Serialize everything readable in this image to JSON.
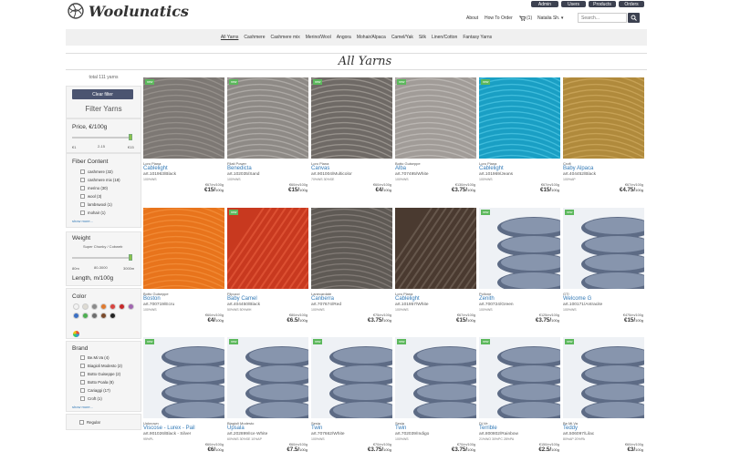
{
  "logo": {
    "text": "Woolunatics"
  },
  "top_buttons": [
    "Admin",
    "Users",
    "Products",
    "Orders"
  ],
  "top_nav": {
    "about": "About",
    "how": "How To Order",
    "cart": "(1)",
    "user": "Natalia Sh."
  },
  "search": {
    "placeholder": "Search..."
  },
  "categories": [
    "All Yarns",
    "Cashmere",
    "Cashmere mix",
    "Merino/Wool",
    "Angora",
    "Mohair/Alpaca",
    "Camel/Yak",
    "Silk",
    "Linen/Cotton",
    "Fantasy Yarns"
  ],
  "page_title": "All Yarns",
  "sidebar": {
    "total": "total 111 yarns",
    "clear": "Clear filter",
    "filter_heading": "Filter Yarns",
    "price": {
      "title": "Price, €/100g",
      "min": "€1",
      "range": "2-15",
      "max": "€15",
      "slider_fraction": 1.0
    },
    "fiber": {
      "title": "Fiber Content",
      "items": [
        "cashmere (32)",
        "cashmere mix (18)",
        "merino (30)",
        "wool (3)",
        "lambswool (1)",
        "mohair (1)"
      ],
      "more": "show more..."
    },
    "weight": {
      "title": "Weight",
      "desc": "Super Chunky / Cobweb",
      "min": "80m",
      "range": "80-3000",
      "max": "3000m",
      "slider_fraction": 1.0
    },
    "length": {
      "title": "Length, m/100g"
    },
    "color": {
      "title": "Color",
      "swatches": [
        "#f2f2f2",
        "#dedbd3",
        "#8a8a8a",
        "#e07a2e",
        "#d9443f",
        "#c62828",
        "#a066b0",
        "#3b6fc4",
        "#4caf50",
        "#6d6d6d",
        "#7b4a2a",
        "#222222"
      ]
    },
    "brand": {
      "title": "Brand",
      "items": [
        "Be.Mi.Va (4)",
        "Biagioli Modesto (2)",
        "Botto Guiseppe (2)",
        "Botto Poala (8)",
        "Cariaggi (17)",
        "Croft (1)"
      ],
      "more": "show more..."
    },
    "regular": "Regular"
  },
  "products": [
    {
      "new": true,
      "brand": "Loro Piana",
      "name": "Cablelight",
      "art": "art.101963/Black",
      "comp": "100%WS",
      "ppu": "€67/m/100g",
      "price": "€15/",
      "unit": "100g",
      "colors": [
        "#7d7874",
        "#a8a39d"
      ],
      "type": "thread"
    },
    {
      "new": true,
      "brand": "Filati Power",
      "name": "Benedicta",
      "art": "art.102035/Sand",
      "comp": "100%WS",
      "ppu": "€60/m/100g",
      "price": "€15/",
      "unit": "100g",
      "colors": [
        "#8e8a86",
        "#c7c3bf"
      ],
      "type": "thread"
    },
    {
      "new": true,
      "brand": "Loro Piana",
      "name": "Canvas",
      "art": "art.901004/Multicolor",
      "comp": "70%WS 30%SE",
      "ppu": "€60/m/100g",
      "price": "€4/",
      "unit": "100g",
      "colors": [
        "#6f6a66",
        "#b8b2ab"
      ],
      "type": "thread"
    },
    {
      "new": true,
      "brand": "Botto Guiseppe",
      "name": "Alba",
      "art": "art.707495/White",
      "comp": "100%WS",
      "ppu": "€130/m/100g",
      "price": "€3.75/",
      "unit": "100g",
      "colors": [
        "#a19c98",
        "#d0ccc8"
      ],
      "type": "thread"
    },
    {
      "new": true,
      "brand": "Loro Piana",
      "name": "Cablelight",
      "art": "art.101969/Jeans",
      "comp": "100%WS",
      "ppu": "€67/m/100g",
      "price": "€15/",
      "unit": "100g",
      "colors": [
        "#1a9fc4",
        "#5fd3ef"
      ],
      "type": "thread"
    },
    {
      "new": false,
      "brand": "Croft",
      "name": "Baby Alpaca",
      "art": "art.404452/Black",
      "comp": "100%AP",
      "ppu": "€67/m/100g",
      "price": "€4.75/",
      "unit": "100g",
      "colors": [
        "#b08a3c",
        "#d9b56a"
      ],
      "type": "thread"
    },
    {
      "new": false,
      "brand": "Botto Guiseppe",
      "name": "Boston",
      "art": "art.700719/Ecru",
      "comp": "100%WS",
      "ppu": "€60/m/100g",
      "price": "€4/",
      "unit": "100g",
      "colors": [
        "#e8741c",
        "#f79a48"
      ],
      "type": "thread"
    },
    {
      "new": true,
      "brand": "Filpucci",
      "name": "Baby Camel",
      "art": "art.404450/Black",
      "comp": "50%WS 50%WH",
      "ppu": "€80/m/100g",
      "price": "€6.5/",
      "unit": "100g",
      "colors": [
        "#c8391f",
        "#e9603f"
      ],
      "type": "cone"
    },
    {
      "new": false,
      "brand": "Lanecardate",
      "name": "Canberra",
      "art": "art.707674/Red",
      "comp": "100%WS",
      "ppu": "€75/m/100g",
      "price": "€3.75/",
      "unit": "100g",
      "colors": [
        "#5f5a55",
        "#9a948e"
      ],
      "type": "thread"
    },
    {
      "new": false,
      "brand": "Loro Piana",
      "name": "Cablelight",
      "art": "art.101957/White",
      "comp": "100%WS",
      "ppu": "€67/m/100g",
      "price": "€15/",
      "unit": "100g",
      "colors": [
        "#4a3a30",
        "#7a6a5f"
      ],
      "type": "cone"
    },
    {
      "new": true,
      "brand": "Pollone",
      "name": "Zenith",
      "art": "art.700724/Green",
      "comp": "100%WS",
      "ppu": "€125/m/100g",
      "price": "€3.75/",
      "unit": "100g",
      "colors": [
        "#5d6b85",
        "#9aa6bd"
      ],
      "type": "spool"
    },
    {
      "new": true,
      "brand": "GTI",
      "name": "Welcome G",
      "art": "art.100171/Antracite",
      "comp": "100%WS",
      "ppu": "€475/m/100g",
      "price": "€15/",
      "unit": "100g",
      "colors": [
        "#5d6b85",
        "#9aa6bd"
      ],
      "type": "spool"
    },
    {
      "new": true,
      "brand": "Unknown",
      "name": "Viscose - Lurex - Pail",
      "art": "art.901026/Black - Silver",
      "comp": "95%PL",
      "ppu": "€60/m/100g",
      "price": "€6/",
      "unit": "100g",
      "colors": [
        "#5d6b85",
        "#9aa6bd"
      ],
      "type": "spool"
    },
    {
      "new": true,
      "brand": "Biagioli Modesto",
      "name": "Upsala",
      "art": "art.202899/Ice White",
      "comp": "60%WS 30%SE 10%AP",
      "ppu": "€60/m/100g",
      "price": "€7.5/",
      "unit": "100g",
      "colors": [
        "#5d6b85",
        "#9aa6bd"
      ],
      "type": "spool"
    },
    {
      "new": true,
      "brand": "Sesia",
      "name": "Twin",
      "art": "art.707662/White",
      "comp": "100%WS",
      "ppu": "€70/m/100g",
      "price": "€3.75/",
      "unit": "100g",
      "colors": [
        "#5d6b85",
        "#9aa6bd"
      ],
      "type": "spool"
    },
    {
      "new": true,
      "brand": "Sesia",
      "name": "Twin",
      "art": "art.702039/Indigo",
      "comp": "100%WS",
      "ppu": "€70/m/100g",
      "price": "€3.75/",
      "unit": "100g",
      "colors": [
        "#5d6b85",
        "#9aa6bd"
      ],
      "type": "spool"
    },
    {
      "new": true,
      "brand": "Di.Ve",
      "name": "Terrible",
      "art": "art.800802/Rainbow",
      "comp": "21%WO 30%PC 28%PA",
      "ppu": "€150/m/100g",
      "price": "€2.5/",
      "unit": "100g",
      "colors": [
        "#5d6b85",
        "#9aa6bd"
      ],
      "type": "spool"
    },
    {
      "new": true,
      "brand": "Be.Mi.Va",
      "name": "Teddy",
      "art": "art.506097/Lilac",
      "comp": "80%AP 20%PA",
      "ppu": "€60/m/100g",
      "price": "€3/",
      "unit": "100g",
      "colors": [
        "#5d6b85",
        "#9aa6bd"
      ],
      "type": "spool"
    }
  ]
}
